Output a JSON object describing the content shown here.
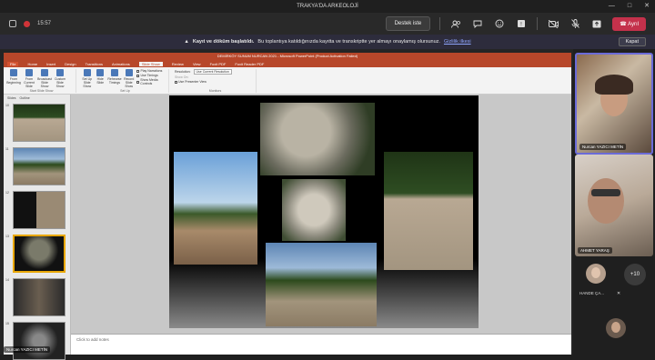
{
  "window": {
    "title": "TRAKYA'DA ARKEOLOJİ",
    "controls": [
      "—",
      "□",
      "✕"
    ]
  },
  "meeting_toolbar": {
    "time": "15:57",
    "support_label": "Destek iste",
    "leave_label": "Ayrıl",
    "icons": [
      "people-icon",
      "chat-icon",
      "reactions-icon",
      "more-icon",
      "camera-off-icon",
      "mic-off-icon",
      "share-icon",
      "phone-icon"
    ]
  },
  "banner": {
    "bold_text": "Kayıt ve döküm başlatıldı.",
    "text": "Bu toplantıya katıldığınızda kayıtta ve transkriptte yer almayı onaylamış olursunuz.",
    "link": "Gizlilik ilkesi",
    "close_label": "Kapat"
  },
  "powerpoint": {
    "title": "DEMİRKÖY SUNUM NURCAN 2021 - Microsoft PowerPoint (Product Activation Failed)",
    "tabs": [
      "File",
      "Home",
      "Insert",
      "Design",
      "Transitions",
      "Animations",
      "Slide Show",
      "Review",
      "View",
      "Foxit PDF",
      "Foxit Reader PDF"
    ],
    "active_tab": "Slide Show",
    "ribbon_groups": [
      {
        "label": "Start Slide Show",
        "buttons": [
          "From Beginning",
          "From Current Slide",
          "Broadcast Slide Show",
          "Custom Slide Show"
        ]
      },
      {
        "label": "Set Up",
        "buttons": [
          "Set Up Slide Show",
          "Hide Slide",
          "Rehearse Timings",
          "Record Slide Show"
        ]
      },
      {
        "label": "Monitors",
        "checks": [
          "Play Narrations",
          "Use Timings",
          "Show Media Controls"
        ],
        "resolution_label": "Resolution:",
        "resolution_value": "Use Current Resolution",
        "show_on_label": "Show On:",
        "presenter_view": "Use Presenter View"
      }
    ],
    "panel_tabs": [
      "Slides",
      "Outline"
    ],
    "slide_numbers": [
      "10",
      "11",
      "12",
      "13",
      "14",
      "15"
    ],
    "selected_slide": "13",
    "notes_placeholder": "Click to add notes"
  },
  "presenter_label": "Nurcan YAZICI METİN",
  "participants": [
    {
      "name": "Nurcan YAZICI METİN"
    },
    {
      "name": "AHMET YARAŞ"
    },
    {
      "name": "HANDE ÇA..."
    }
  ],
  "more_count": "+10",
  "colors": {
    "accent": "#6b6bd8",
    "leave": "#c4314b",
    "ppt": "#b7472a"
  }
}
